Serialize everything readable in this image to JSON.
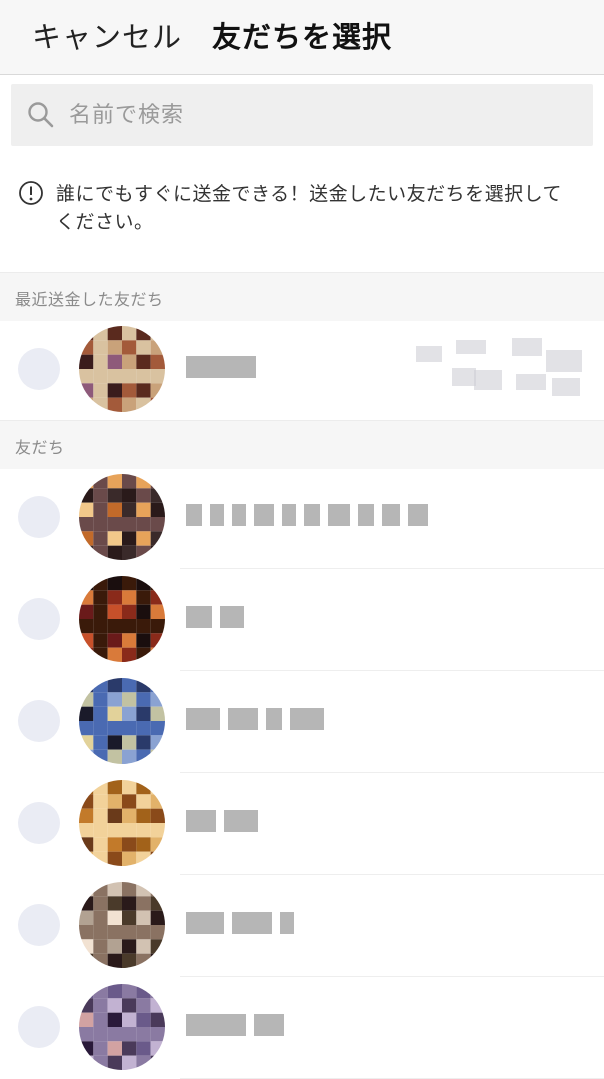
{
  "header": {
    "cancel_label": "キャンセル",
    "title": "友だちを選択"
  },
  "search": {
    "placeholder": "名前で検索",
    "icon": "search-icon"
  },
  "notice": {
    "icon": "info-icon",
    "text": "誰にでもすぐに送金できる！送金したい友だちを選択してください。"
  },
  "sections": {
    "recent_label": "最近送金した友だち",
    "friends_label": "友だち"
  },
  "recent": [
    {
      "name": "",
      "avatar_colors": [
        "#5a2a1e",
        "#c9a27a",
        "#8e5a7a",
        "#d9c2a0",
        "#3a1c1c",
        "#a35a3a"
      ]
    }
  ],
  "friends": [
    {
      "name": "",
      "avatar_colors": [
        "#e7a35a",
        "#3a2a2a",
        "#c26a2a",
        "#6a4a4a",
        "#f2c88a",
        "#2a1a1a"
      ]
    },
    {
      "name": "",
      "avatar_colors": [
        "#1a0e0e",
        "#8a2a1a",
        "#c7502a",
        "#3a1a0a",
        "#6a1a1a",
        "#d97a3a"
      ]
    },
    {
      "name": "",
      "avatar_colors": [
        "#2a3a6a",
        "#8aa2d2",
        "#e2d29a",
        "#4a6ab2",
        "#1a1a2a",
        "#c2c2a2"
      ]
    },
    {
      "name": "",
      "avatar_colors": [
        "#a2621a",
        "#e2b26a",
        "#6a3a1a",
        "#f2d29a",
        "#c27a2a",
        "#8a4a1a"
      ]
    },
    {
      "name": "",
      "avatar_colors": [
        "#d2c2b2",
        "#4a3a2a",
        "#f2e2d2",
        "#8a7262",
        "#b2a292",
        "#2a1a1a"
      ]
    },
    {
      "name": "",
      "avatar_colors": [
        "#6a5a8a",
        "#c2b2d2",
        "#2a1a3a",
        "#8a7aa2",
        "#d2a2a2",
        "#4a3a5a"
      ]
    }
  ],
  "colors": {
    "radio_fill": "#eaecf4",
    "section_bg": "#f6f6f6",
    "search_bg": "#efefef"
  }
}
